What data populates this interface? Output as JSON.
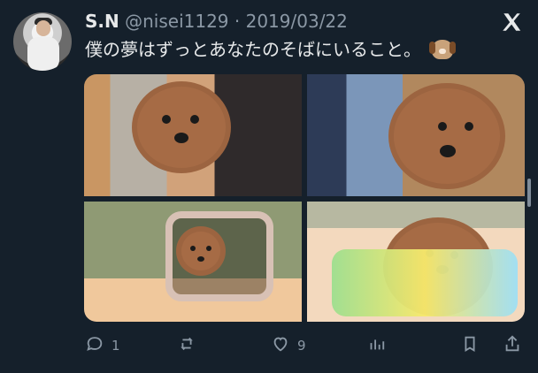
{
  "tweet": {
    "display_name": "S.N",
    "handle": "@nisei1129",
    "separator": " · ",
    "date": "2019/03/22",
    "text": "僕の夢はずっとあなたのそばにいること。",
    "emoji": "dog-face-emoji"
  },
  "media": {
    "tiles": [
      {
        "alt": ""
      },
      {
        "alt": ""
      },
      {
        "alt": ""
      },
      {
        "alt": ""
      }
    ]
  },
  "actions": {
    "reply_count": "1",
    "retweet_count": "",
    "like_count": "9"
  },
  "icons": {
    "x_logo": "x-logo-icon",
    "reply": "reply-icon",
    "retweet": "retweet-icon",
    "like": "heart-icon",
    "analytics": "analytics-icon",
    "bookmark": "bookmark-icon",
    "share": "share-icon"
  },
  "colors": {
    "background": "#15202b",
    "text_primary": "#e7e9ea",
    "text_secondary": "#8b98a5"
  }
}
